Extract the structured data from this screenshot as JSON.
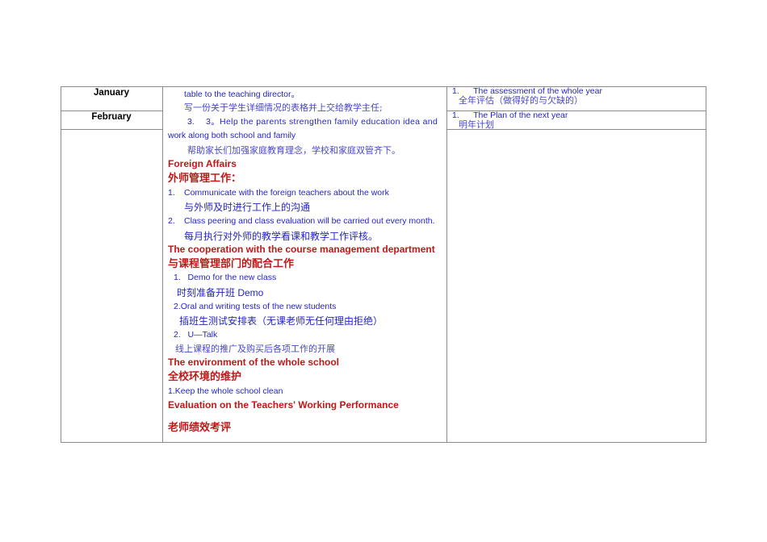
{
  "months": [
    "January",
    "February"
  ],
  "middle": {
    "l1": "table to the teaching director。",
    "l2": "写一份关于学生详细情况的表格并上交给教学主任;",
    "l3a": "3.",
    "l3": "3。Help the parents strengthen family education idea and",
    "l4": "work along both school and family",
    "l5": "帮助家长们加强家庭教育理念，学校和家庭双管齐下。",
    "h1": "Foreign Affairs",
    "h1cn": "外师管理工作：",
    "f1n": "1.",
    "f1": "Communicate with the foreign teachers about the work",
    "f1cn": "与外师及时进行工作上的沟通",
    "f2n": "2.",
    "f2": "Class peering and class evaluation will be carried out every month.",
    "f2cn": "每月执行对外师的教学看课和教学工作评核。",
    "h2": "The cooperation with the course management department",
    "h2cn": "与课程管理部门的配合工作",
    "c1": "1.   Demo for the new class",
    "c1cn": "时刻准备开班 Demo",
    "c2": "2.Oral and writing tests of the new students",
    "c2cn": "插班生测试安排表（无课老师无任何理由拒绝）",
    "c3": "2.   U—Talk",
    "c3cn": "线上课程的推广及购买后各项工作的开展",
    "h3": "The environment of the whole school",
    "h3cn": "全校环境的维护",
    "e1": "1.Keep the whole school clean",
    "h4": "Evaluation on the Teachers' Working Performance",
    "h4cn": "老师绩效考评"
  },
  "right": {
    "a1": "1.      The assessment of the whole year",
    "a1cn": "全年评估（做得好的与欠缺的）",
    "a2": "1.      The Plan of the next year",
    "a2cn": "明年计划"
  }
}
